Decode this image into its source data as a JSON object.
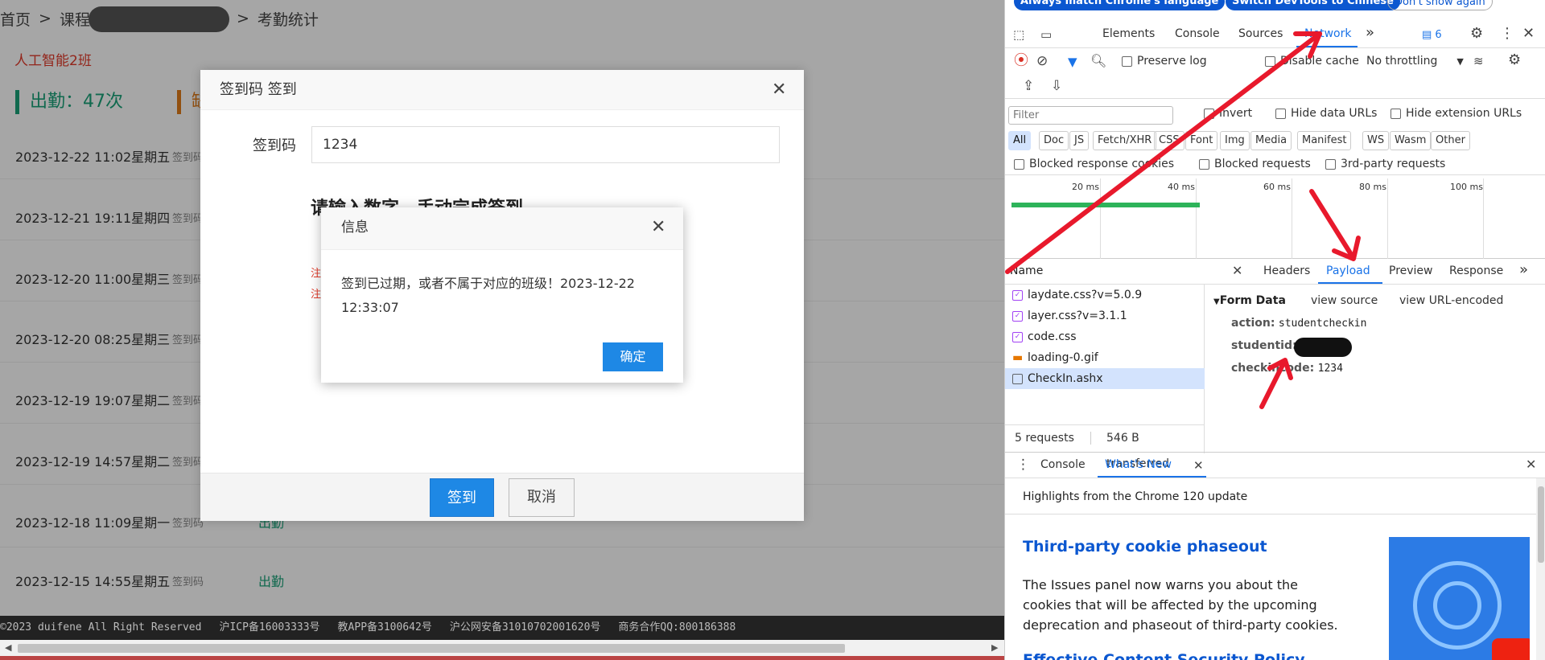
{
  "page": {
    "breadcrumb": {
      "home": "首页",
      "sep": ">",
      "course": "课程",
      "current": "考勤统计"
    },
    "class_name": "人工智能2班",
    "stats": {
      "attend": "出勤：47次",
      "other": "缺"
    },
    "records": [
      {
        "date": "2023-12-22 11:02星期五",
        "source": "签到码",
        "state": ""
      },
      {
        "date": "2023-12-21 19:11星期四",
        "source": "签到码",
        "state": ""
      },
      {
        "date": "2023-12-20 11:00星期三",
        "source": "签到码",
        "state": ""
      },
      {
        "date": "2023-12-20 08:25星期三",
        "source": "签到码",
        "state": ""
      },
      {
        "date": "2023-12-19 19:07星期二",
        "source": "签到码",
        "state": ""
      },
      {
        "date": "2023-12-19 14:57星期二",
        "source": "签到码",
        "state": ""
      },
      {
        "date": "2023-12-18 11:09星期一",
        "source": "签到码",
        "state": "出勤"
      },
      {
        "date": "2023-12-15 14:55星期五",
        "source": "签到码",
        "state": "出勤"
      }
    ],
    "footer": {
      "copyright": "©2023 duifene All Right Reserved",
      "icp": "沪ICP备16003333号",
      "app": "教APP备3100642号",
      "police": "沪公网安备31010702001620号",
      "contact": "商务合作QQ:800186388"
    }
  },
  "checkin_dialog": {
    "title": "签到码 签到",
    "code_label": "签到码",
    "code_value": "1234",
    "tip": "请输入数字，手动完成签到",
    "note1": "注",
    "note2": "注",
    "submit": "签到",
    "cancel": "取消"
  },
  "info_dialog": {
    "title": "信息",
    "message": "签到已过期，或者不属于对应的班级！2023-12-22 12:33:07",
    "ok": "确定"
  },
  "devtools": {
    "infobar": {
      "match_language": "Always match Chrome's language",
      "switch_chinese": "Switch DevTools to Chinese",
      "dont_show": "Don't show again"
    },
    "tabs": [
      "Elements",
      "Console",
      "Sources",
      "Network"
    ],
    "more_tabs": "»",
    "issues_count": "6",
    "toolbar": {
      "preserve_log": "Preserve log",
      "disable_cache": "Disable cache",
      "throttling": "No throttling"
    },
    "filter": {
      "placeholder": "Filter",
      "invert": "Invert",
      "hide_data": "Hide data URLs",
      "hide_ext": "Hide extension URLs"
    },
    "type_chips": [
      "All",
      "Doc",
      "JS",
      "Fetch/XHR",
      "CSS",
      "Font",
      "Img",
      "Media",
      "Manifest",
      "WS",
      "Wasm",
      "Other"
    ],
    "blocked": {
      "cookies": "Blocked response cookies",
      "requests": "Blocked requests",
      "third_party": "3rd-party requests"
    },
    "timeline_ticks": [
      "20 ms",
      "40 ms",
      "60 ms",
      "80 ms",
      "100 ms"
    ],
    "name_header": "Name",
    "detail_tabs": [
      "Headers",
      "Payload",
      "Preview",
      "Response"
    ],
    "requests": [
      "laydate.css?v=5.0.9",
      "layer.css?v=3.1.1",
      "code.css",
      "loading-0.gif",
      "CheckIn.ashx"
    ],
    "payload": {
      "section": "Form Data",
      "view_source": "view source",
      "view_url": "view URL-encoded",
      "rows": [
        {
          "key": "action:",
          "value": "studentcheckin"
        },
        {
          "key": "studentid:",
          "value": ""
        },
        {
          "key": "checkincode:",
          "value": "1234"
        }
      ]
    },
    "status": {
      "requests": "5 requests",
      "transferred": "546 B transferred"
    },
    "drawer": {
      "tab_console": "Console",
      "tab_whats_new": "What's New",
      "highlights": "Highlights from the Chrome 120 update",
      "heading": "Third-party cookie phaseout",
      "body": "The Issues panel now warns you about the cookies that will be affected by the upcoming deprecation and phaseout of third-party cookies.",
      "next_heading": "Effective Content Security Policy"
    },
    "colors": {
      "accent": "#1a73e8",
      "selected_bg": "#d3e3fd",
      "annotation": "#e8192c"
    }
  }
}
